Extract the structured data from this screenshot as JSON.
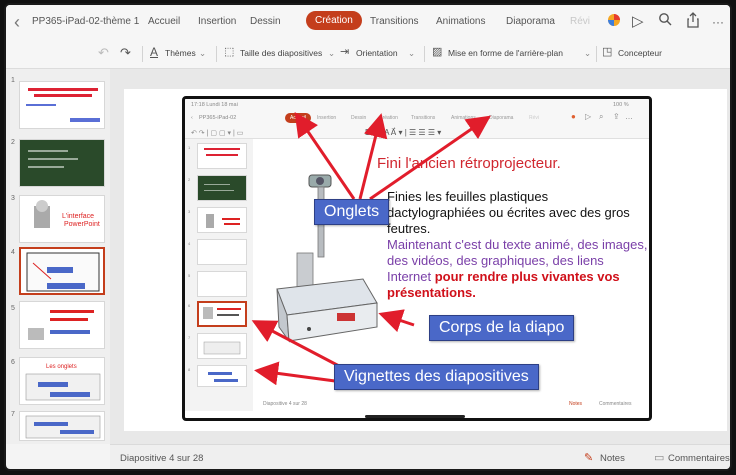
{
  "header": {
    "doc_title": "PP365-iPad-02-thème 1",
    "tabs": [
      {
        "label": "Accueil"
      },
      {
        "label": "Insertion"
      },
      {
        "label": "Dessin"
      },
      {
        "label": "Création",
        "active": true
      },
      {
        "label": "Transitions"
      },
      {
        "label": "Animations"
      },
      {
        "label": "Diaporama"
      },
      {
        "label": "Révi"
      }
    ]
  },
  "toolbar": {
    "themes": "Thèmes",
    "slide_size": "Taille des diapositives",
    "orientation": "Orientation",
    "background": "Mise en forme de l'arrière-plan",
    "designer": "Concepteur"
  },
  "slides_panel": {
    "numbers": [
      "1",
      "2",
      "3",
      "4",
      "5",
      "6",
      "7"
    ]
  },
  "inner_app": {
    "time": "17:18 Lundi 18 mai",
    "battery": "100 %",
    "doc_title": "PP365-iPad-02",
    "tabs": [
      "Accueil",
      "Insertion",
      "Dessin",
      "Création",
      "Transitions",
      "Animations",
      "Diaporama",
      "Révi"
    ],
    "status": "Diapositive 4 sur 28",
    "notes": "Notes",
    "comments": "Commentaires"
  },
  "slide": {
    "title": "Fini l'ancien rétroprojecteur.",
    "body_black": "Finies les feuilles plastiques dactylographiées ou écrites avec des gros feutres.",
    "body_purple": "Maintenant c'est du texte animé, des images, des vidéos, des graphiques, des liens Internet",
    "body_red": "pour rendre plus vivantes vos présentations."
  },
  "annotations": {
    "tabs": "Onglets",
    "body": "Corps de la diapo",
    "thumbs": "Vignettes des diapositives"
  },
  "statusbar": {
    "slide_counter": "Diapositive 4 sur 28",
    "notes": "Notes",
    "comments": "Commentaires"
  },
  "colors": {
    "accent": "#c43e1c",
    "callout": "#4a68c8",
    "title_red": "#d0272f",
    "purple": "#7a3fa8"
  }
}
